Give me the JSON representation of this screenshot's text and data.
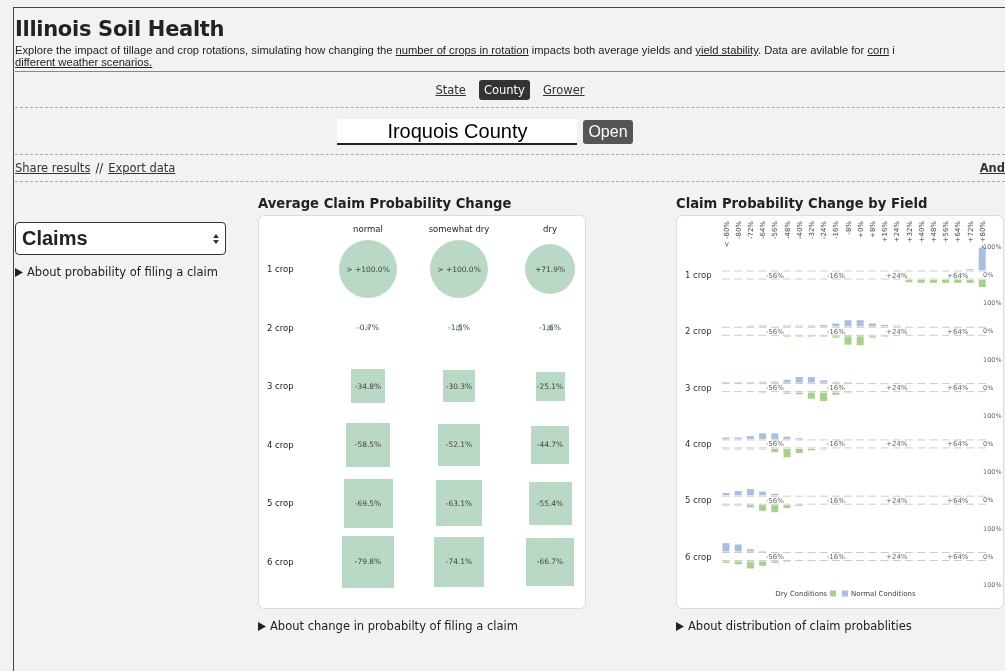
{
  "header": {
    "title": "Illinois Soil Health",
    "description_lines": [
      [
        {
          "kind": "text",
          "text": "Explore the impact of tillage and crop rotations, simulating how changing the "
        },
        {
          "kind": "link",
          "text": "number of crops in rotation"
        },
        {
          "kind": "text",
          "text": " impacts both average yields and "
        },
        {
          "kind": "link",
          "text": "yield stability"
        },
        {
          "kind": "text",
          "text": ". Data are avilable for "
        },
        {
          "kind": "link",
          "text": "corn"
        },
        {
          "kind": "text",
          "text": " i"
        }
      ],
      [
        {
          "kind": "link",
          "text": "different weather scenarios."
        }
      ]
    ]
  },
  "tabs": [
    {
      "label": "State",
      "selected": false
    },
    {
      "label": "County",
      "selected": true
    },
    {
      "label": "Grower",
      "selected": false
    }
  ],
  "search": {
    "value": "Iroquois County",
    "button": "Open"
  },
  "actions": {
    "share": "Share results",
    "separator": "//",
    "export": "Export data",
    "right_link": "And"
  },
  "metric_select": {
    "value": "Claims"
  },
  "about_metric": "About probability of filing a claim",
  "average_panel": {
    "title": "Average Claim Probability Change",
    "columns": [
      "normal",
      "somewhat dry",
      "dry"
    ],
    "rows": [
      {
        "label": "1 crop",
        "cells": [
          {
            "kind": "circle",
            "text": "> +100.0%"
          },
          {
            "kind": "circle",
            "text": "> +100.0%"
          },
          {
            "kind": "circle",
            "text": "+71.9%"
          }
        ]
      },
      {
        "label": "2 crop",
        "cells": [
          {
            "kind": "square",
            "text": "-0.7%"
          },
          {
            "kind": "square",
            "text": "-1.5%"
          },
          {
            "kind": "square",
            "text": "-1.6%"
          }
        ]
      },
      {
        "label": "3 crop",
        "cells": [
          {
            "kind": "square",
            "text": "-34.8%"
          },
          {
            "kind": "square",
            "text": "-30.3%"
          },
          {
            "kind": "square",
            "text": "-25.1%"
          }
        ]
      },
      {
        "label": "4 crop",
        "cells": [
          {
            "kind": "square",
            "text": "-58.5%"
          },
          {
            "kind": "square",
            "text": "-52.1%"
          },
          {
            "kind": "square",
            "text": "-44.7%"
          }
        ]
      },
      {
        "label": "5 crop",
        "cells": [
          {
            "kind": "square",
            "text": "-69.5%"
          },
          {
            "kind": "square",
            "text": "-63.1%"
          },
          {
            "kind": "square",
            "text": "-55.4%"
          }
        ]
      },
      {
        "label": "6 crop",
        "cells": [
          {
            "kind": "square",
            "text": "-79.8%"
          },
          {
            "kind": "square",
            "text": "-74.1%"
          },
          {
            "kind": "square",
            "text": "-66.7%"
          }
        ]
      }
    ],
    "about": "About change in probabilty of filing a claim"
  },
  "field_panel": {
    "title": "Claim Probability Change by Field",
    "bins": [
      "< -80%",
      "-80%",
      "-72%",
      "-64%",
      "-56%",
      "-48%",
      "-40%",
      "-32%",
      "-24%",
      "-16%",
      "-8%",
      "+0%",
      "+8%",
      "+16%",
      "+24%",
      "+32%",
      "+40%",
      "+48%",
      "+56%",
      "+64%",
      "+72%",
      "> +80%"
    ],
    "rows": [
      {
        "label": "1 crop",
        "markers": [
          "-56%",
          "-16%",
          "+24%",
          "+64%"
        ],
        "axis": [
          "100%",
          "0%"
        ]
      },
      {
        "label": "2 crop",
        "markers": [
          "-56%",
          "-16%",
          "+24%",
          "+64%"
        ],
        "axis": [
          "100%",
          "0%"
        ]
      },
      {
        "label": "3 crop",
        "markers": [
          "-56%",
          "-16%",
          "+24%",
          "+64%"
        ],
        "axis": [
          "100%",
          "0%"
        ]
      },
      {
        "label": "4 crop",
        "markers": [
          "-56%",
          "-16%",
          "+24%",
          "+64%"
        ],
        "axis": [
          "100%",
          "0%"
        ]
      },
      {
        "label": "5 crop",
        "markers": [
          "-56%",
          "-16%",
          "+24%",
          "+64%"
        ],
        "axis": [
          "100%",
          "0%"
        ]
      },
      {
        "label": "6 crop",
        "markers": [
          "-56%",
          "-16%",
          "+24%",
          "+64%"
        ],
        "axis": [
          "100%",
          "0%",
          "100%"
        ]
      }
    ],
    "legend": [
      {
        "label": "Dry Conditions",
        "color": "#a8d08d"
      },
      {
        "label": "Normal Conditions",
        "color": "#a9bfe0"
      }
    ],
    "about": "About distribution of claim probablities"
  }
}
